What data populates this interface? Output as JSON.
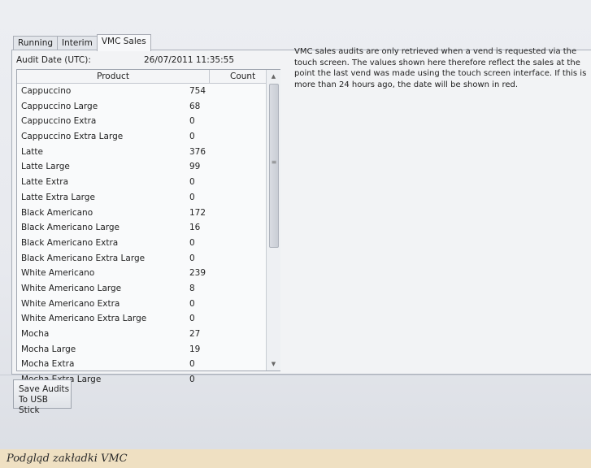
{
  "tabs": [
    {
      "label": "Running",
      "active": false
    },
    {
      "label": "Interim",
      "active": false
    },
    {
      "label": "VMC Sales",
      "active": true
    }
  ],
  "audit": {
    "label": "Audit Date (UTC):",
    "value": "26/07/2011 11:35:55"
  },
  "description": "VMC sales audits are only retrieved when a vend is requested via the touch screen. The values shown here therefore reflect the sales at the point the last vend was made using the touch screen interface. If this is more than 24 hours ago, the date will be shown in red.",
  "table": {
    "columns": [
      "Product",
      "Count"
    ],
    "rows": [
      [
        "Cappuccino",
        "754"
      ],
      [
        "Cappuccino Large",
        "68"
      ],
      [
        "Cappuccino Extra",
        "0"
      ],
      [
        "Cappuccino Extra Large",
        "0"
      ],
      [
        "Latte",
        "376"
      ],
      [
        "Latte Large",
        "99"
      ],
      [
        "Latte Extra",
        "0"
      ],
      [
        "Latte Extra Large",
        "0"
      ],
      [
        "Black Americano",
        "172"
      ],
      [
        "Black Americano Large",
        "16"
      ],
      [
        "Black Americano Extra",
        "0"
      ],
      [
        "Black Americano Extra Large",
        "0"
      ],
      [
        "White Americano",
        "239"
      ],
      [
        "White Americano Large",
        "8"
      ],
      [
        "White Americano Extra",
        "0"
      ],
      [
        "White Americano Extra Large",
        "0"
      ],
      [
        "Mocha",
        "27"
      ],
      [
        "Mocha Large",
        "19"
      ],
      [
        "Mocha Extra",
        "0"
      ],
      [
        "Mocha Extra Large",
        "0"
      ]
    ]
  },
  "save_button": {
    "line1": "Save Audits",
    "line2": "To USB Stick"
  },
  "caption": "Podgląd zakładki VMC"
}
